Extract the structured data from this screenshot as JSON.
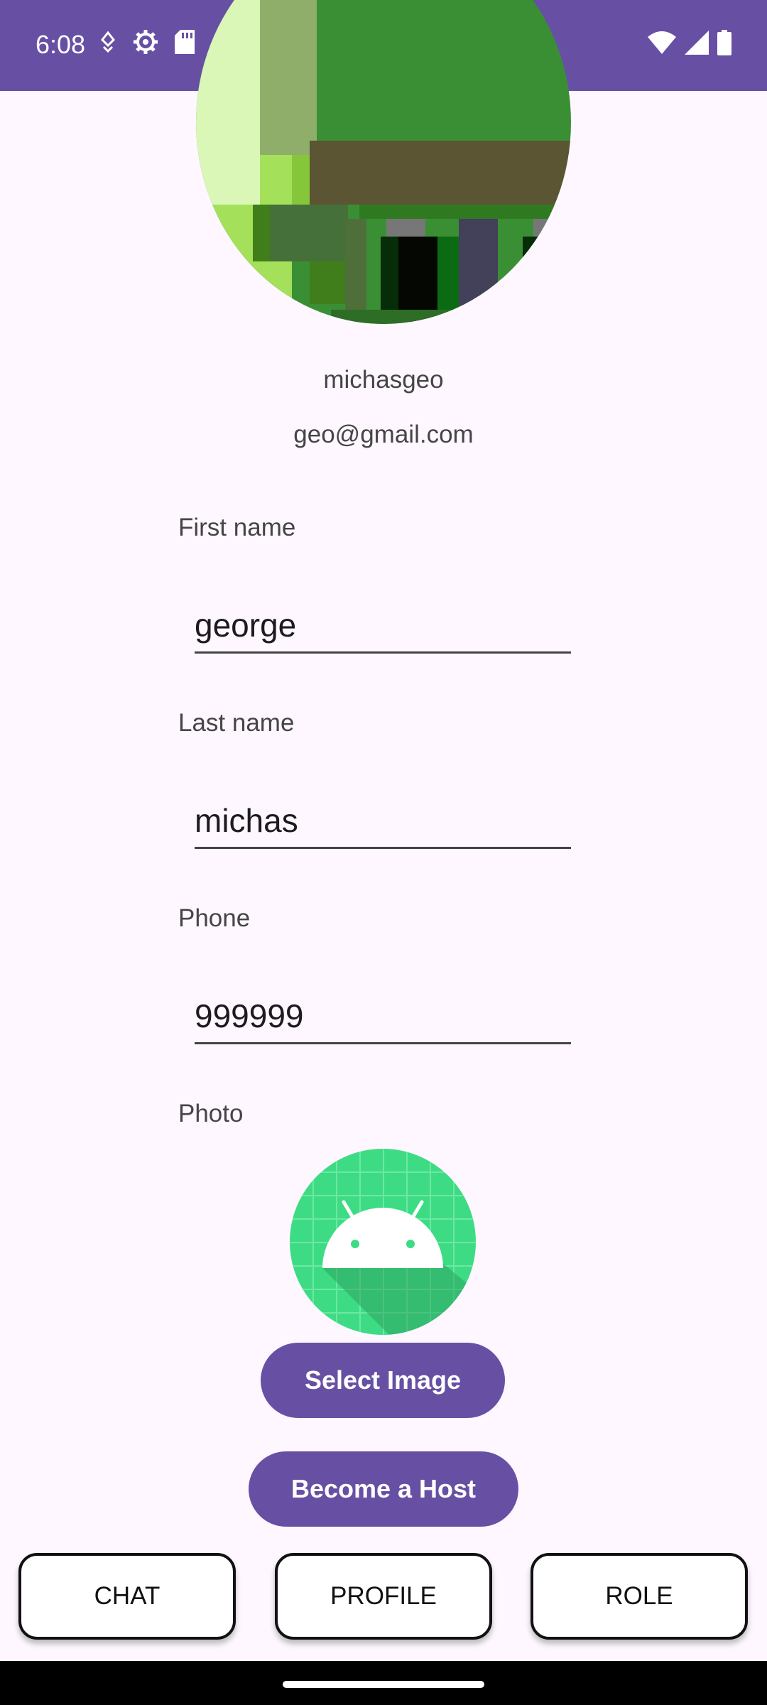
{
  "status_bar": {
    "time": "6:08",
    "left_icons": [
      "location-icon",
      "settings-icon",
      "sd-card-icon"
    ],
    "right_icons": [
      "wifi-icon",
      "signal-icon",
      "battery-icon"
    ],
    "color": "#6750A4"
  },
  "profile": {
    "username": "michasgeo",
    "email": "geo@gmail.com",
    "avatar_icon": "pixel-avatar-image"
  },
  "form": {
    "first_name": {
      "label": "First name",
      "value": "george"
    },
    "last_name": {
      "label": "Last name",
      "value": "michas"
    },
    "phone": {
      "label": "Phone",
      "value": "999999"
    },
    "photo": {
      "label": "Photo",
      "icon": "android-icon"
    }
  },
  "buttons": {
    "select_image": "Select Image",
    "become_host": "Become a Host"
  },
  "bottom_nav": {
    "chat": "CHAT",
    "profile": "PROFILE",
    "role": "ROLE"
  },
  "colors": {
    "accent": "#6750A4",
    "background": "#FEF7FF"
  }
}
